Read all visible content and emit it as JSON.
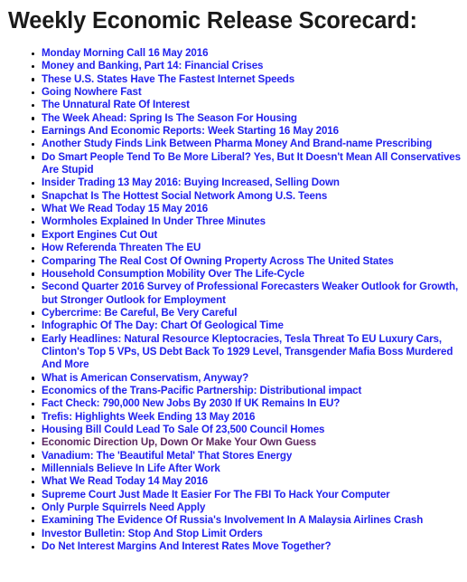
{
  "page": {
    "title": "Weekly Economic Release Scorecard:",
    "background_color": "#ffffff",
    "title_color": "#1b1b1b",
    "link_color": "#2222ee",
    "visited_link_color": "#5e2763",
    "bullet_color": "#000000"
  },
  "list": {
    "marker": "bullet-disc",
    "items": [
      {
        "label": "Monday Morning Call 16 May 2016",
        "state": "unvisited"
      },
      {
        "label": "Money and Banking, Part 14: Financial Crises",
        "state": "unvisited"
      },
      {
        "label": "These U.S. States Have The Fastest Internet Speeds",
        "state": "unvisited"
      },
      {
        "label": "Going Nowhere Fast",
        "state": "unvisited"
      },
      {
        "label": "The Unnatural Rate Of Interest",
        "state": "unvisited"
      },
      {
        "label": "The Week Ahead: Spring Is The Season For Housing",
        "state": "unvisited"
      },
      {
        "label": "Earnings And Economic Reports: Week Starting 16 May 2016",
        "state": "unvisited"
      },
      {
        "label": "Another Study Finds Link Between Pharma Money And Brand-name Prescribing",
        "state": "unvisited"
      },
      {
        "label": "Do Smart People Tend To Be More Liberal? Yes, But It Doesn't Mean All Conservatives Are Stupid",
        "state": "unvisited"
      },
      {
        "label": "Insider Trading 13 May 2016: Buying Increased, Selling Down",
        "state": "unvisited"
      },
      {
        "label": "Snapchat Is The Hottest Social Network Among U.S. Teens",
        "state": "unvisited"
      },
      {
        "label": "What We Read Today 15 May 2016",
        "state": "unvisited"
      },
      {
        "label": "Wormholes Explained In Under Three Minutes",
        "state": "unvisited"
      },
      {
        "label": "Export Engines Cut Out",
        "state": "unvisited"
      },
      {
        "label": "How Referenda Threaten The EU",
        "state": "unvisited"
      },
      {
        "label": "Comparing The Real Cost Of Owning Property Across The United States",
        "state": "unvisited"
      },
      {
        "label": "Household Consumption Mobility Over The Life-Cycle",
        "state": "unvisited"
      },
      {
        "label": "Second Quarter 2016 Survey of Professional Forecasters Weaker Outlook for Growth, but Stronger Outlook for Employment",
        "state": "unvisited"
      },
      {
        "label": "Cybercrime: Be Careful, Be Very Careful",
        "state": "unvisited"
      },
      {
        "label": "Infographic Of The Day: Chart Of Geological Time",
        "state": "unvisited"
      },
      {
        "label": "Early Headlines: Natural Resource Kleptocracies, Tesla Threat To EU Luxury Cars, Clinton's Top 5 VPs, US Debt Back To 1929 Level, Transgender Mafia Boss Murdered And More",
        "state": "unvisited"
      },
      {
        "label": "What is American Conservatism, Anyway?",
        "state": "unvisited"
      },
      {
        "label": "Economics of the Trans-Pacific Partnership: Distributional impact",
        "state": "unvisited"
      },
      {
        "label": "Fact Check: 790,000 New Jobs By 2030 If UK Remains In EU?",
        "state": "unvisited"
      },
      {
        "label": "Trefis: Highlights Week Ending 13 May 2016",
        "state": "unvisited"
      },
      {
        "label": "Housing Bill Could Lead To Sale Of 23,500 Council Homes",
        "state": "unvisited"
      },
      {
        "label": "Economic Direction Up, Down Or Make Your Own Guess",
        "state": "visited"
      },
      {
        "label": "Vanadium: The 'Beautiful Metal' That Stores Energy",
        "state": "unvisited"
      },
      {
        "label": "Millennials Believe In Life After Work",
        "state": "unvisited"
      },
      {
        "label": "What We Read Today 14 May 2016",
        "state": "unvisited"
      },
      {
        "label": "Supreme Court Just Made It Easier For The FBI To Hack Your Computer",
        "state": "unvisited"
      },
      {
        "label": "Only Purple Squirrels Need Apply",
        "state": "unvisited"
      },
      {
        "label": "Examining The Evidence Of Russia's Involvement In A Malaysia Airlines Crash",
        "state": "unvisited"
      },
      {
        "label": "Investor Bulletin: Stop And Stop Limit Orders",
        "state": "unvisited"
      },
      {
        "label": "Do Net Interest Margins And Interest Rates Move Together?",
        "state": "unvisited"
      }
    ]
  }
}
